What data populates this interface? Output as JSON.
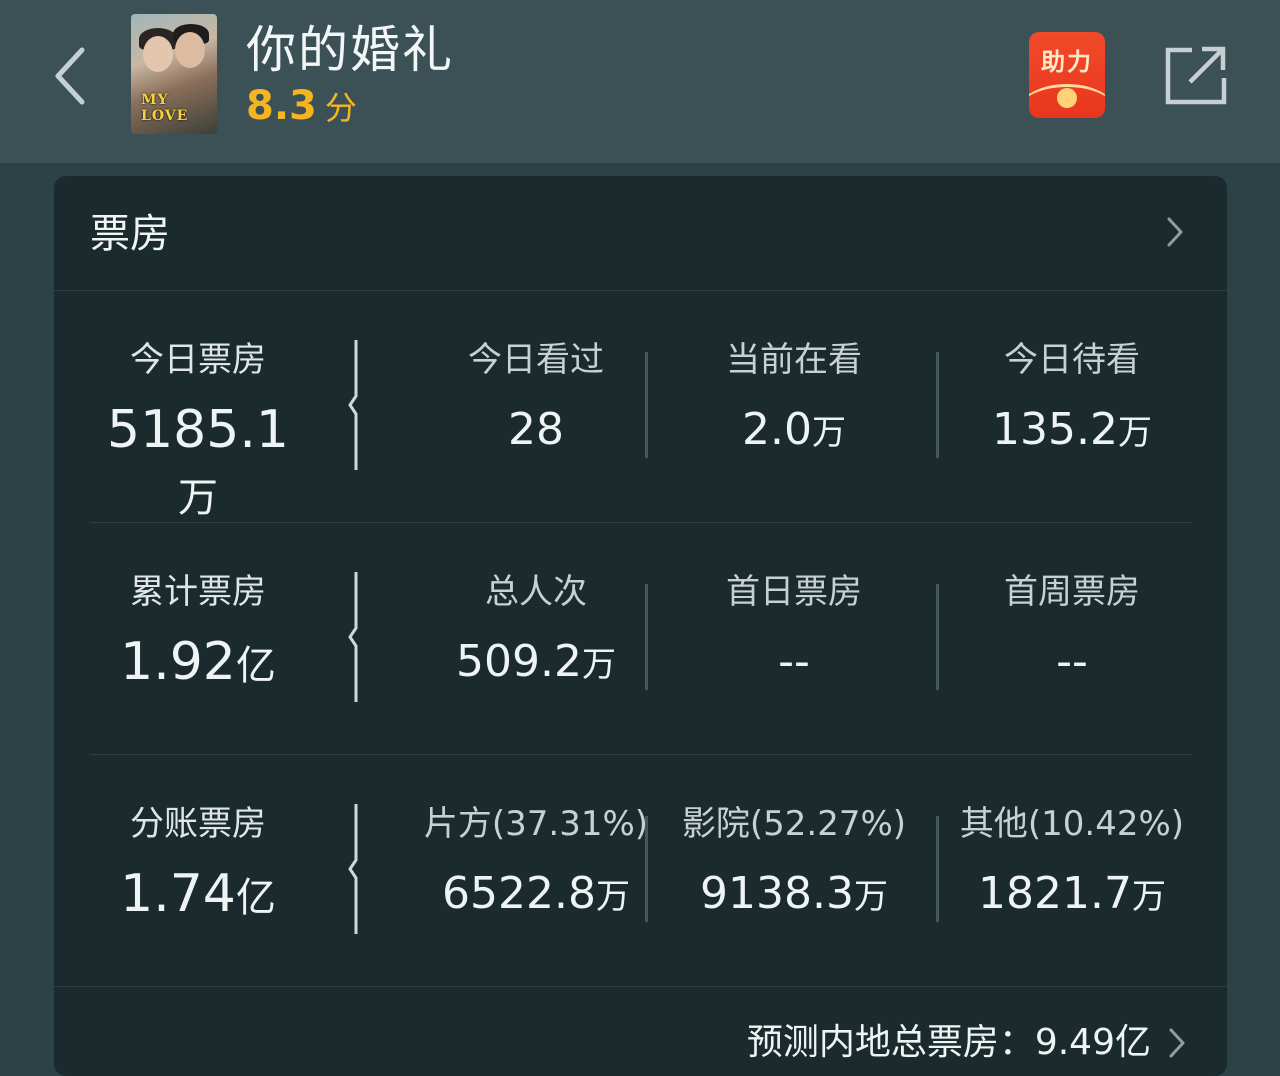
{
  "header": {
    "title": "你的婚礼",
    "rating_value": "8.3",
    "rating_unit": "分",
    "poster_text": "MY LOVE",
    "boost_label": "助力"
  },
  "card": {
    "title": "票房"
  },
  "rows": [
    {
      "main": {
        "label": "今日票房",
        "value": "5185.1",
        "unit": "万"
      },
      "cells": [
        {
          "label": "今日看过",
          "value": "28",
          "unit": ""
        },
        {
          "label": "当前在看",
          "value": "2.0",
          "unit": "万"
        },
        {
          "label": "今日待看",
          "value": "135.2",
          "unit": "万"
        }
      ]
    },
    {
      "main": {
        "label": "累计票房",
        "value": "1.92",
        "unit": "亿"
      },
      "cells": [
        {
          "label": "总人次",
          "value": "509.2",
          "unit": "万"
        },
        {
          "label": "首日票房",
          "value": "--",
          "unit": ""
        },
        {
          "label": "首周票房",
          "value": "--",
          "unit": ""
        }
      ]
    },
    {
      "main": {
        "label": "分账票房",
        "value": "1.74",
        "unit": "亿"
      },
      "cells": [
        {
          "label": "片方(37.31%)",
          "value": "6522.8",
          "unit": "万"
        },
        {
          "label": "影院(52.27%)",
          "value": "9138.3",
          "unit": "万"
        },
        {
          "label": "其他(10.42%)",
          "value": "1821.7",
          "unit": "万"
        }
      ]
    }
  ],
  "forecast": {
    "text": "预测内地总票房：9.49亿"
  },
  "icons": {
    "back": "chevron-left-icon",
    "share": "share-external-icon",
    "more": "chevron-right-icon"
  },
  "colors": {
    "header_bg": "#3b5156",
    "card_bg": "#1b2a2d",
    "rating": "#f5b520",
    "boost": "#e8361e"
  }
}
